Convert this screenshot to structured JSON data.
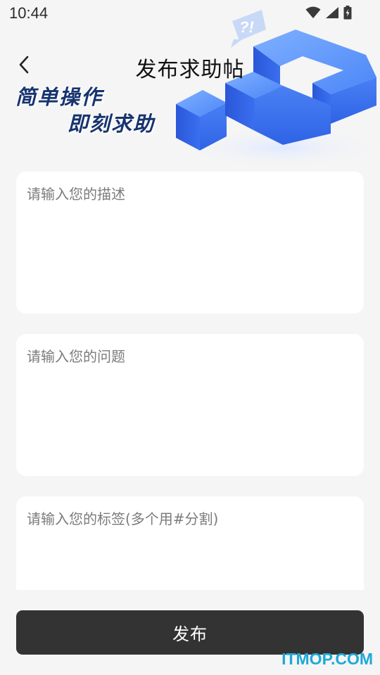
{
  "status_bar": {
    "time": "10:44",
    "icons": [
      "wifi-icon",
      "cellular-signal-icon",
      "battery-charging-icon"
    ]
  },
  "header": {
    "title": "发布求助帖",
    "back_icon": "chevron-left-icon"
  },
  "banner": {
    "slogan_line1": "简单操作",
    "slogan_line2": "即刻求助",
    "bubble_text": "?!",
    "accent_color": "#3f7df6"
  },
  "form": {
    "description_placeholder": "请输入您的描述",
    "question_placeholder": "请输入您的问题",
    "tags_placeholder": "请输入您的标签(多个用#分割)"
  },
  "actions": {
    "submit_label": "发布"
  },
  "watermark": "ITMOP.COM",
  "colors": {
    "background": "#f5f5f5",
    "card": "#ffffff",
    "button": "#333333",
    "slogan": "#17346f",
    "watermark": "#1ea9d6"
  }
}
